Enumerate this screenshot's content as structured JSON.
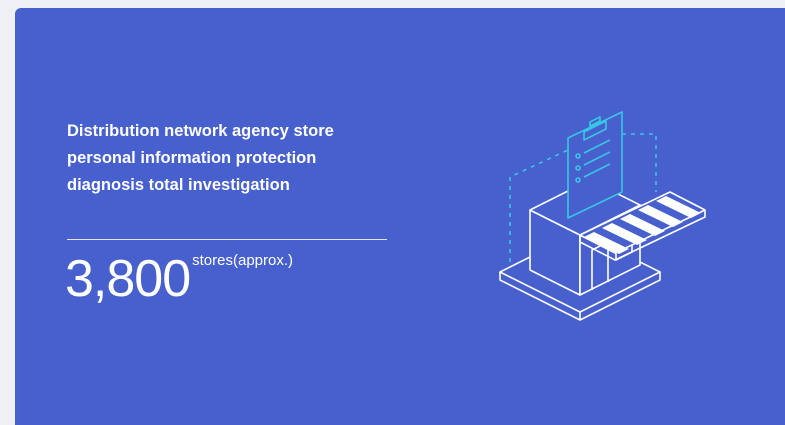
{
  "card": {
    "background": "#4760cd",
    "description": "Distribution network agency store personal information protection diagnosis total investigation",
    "stat": {
      "value": "3,800",
      "unit": "stores(approx.)"
    }
  },
  "illustration": {
    "icon": "storefront-clipboard-icon",
    "line_color": "#ffffff",
    "dashed_accent_color": "#38c6e4"
  }
}
